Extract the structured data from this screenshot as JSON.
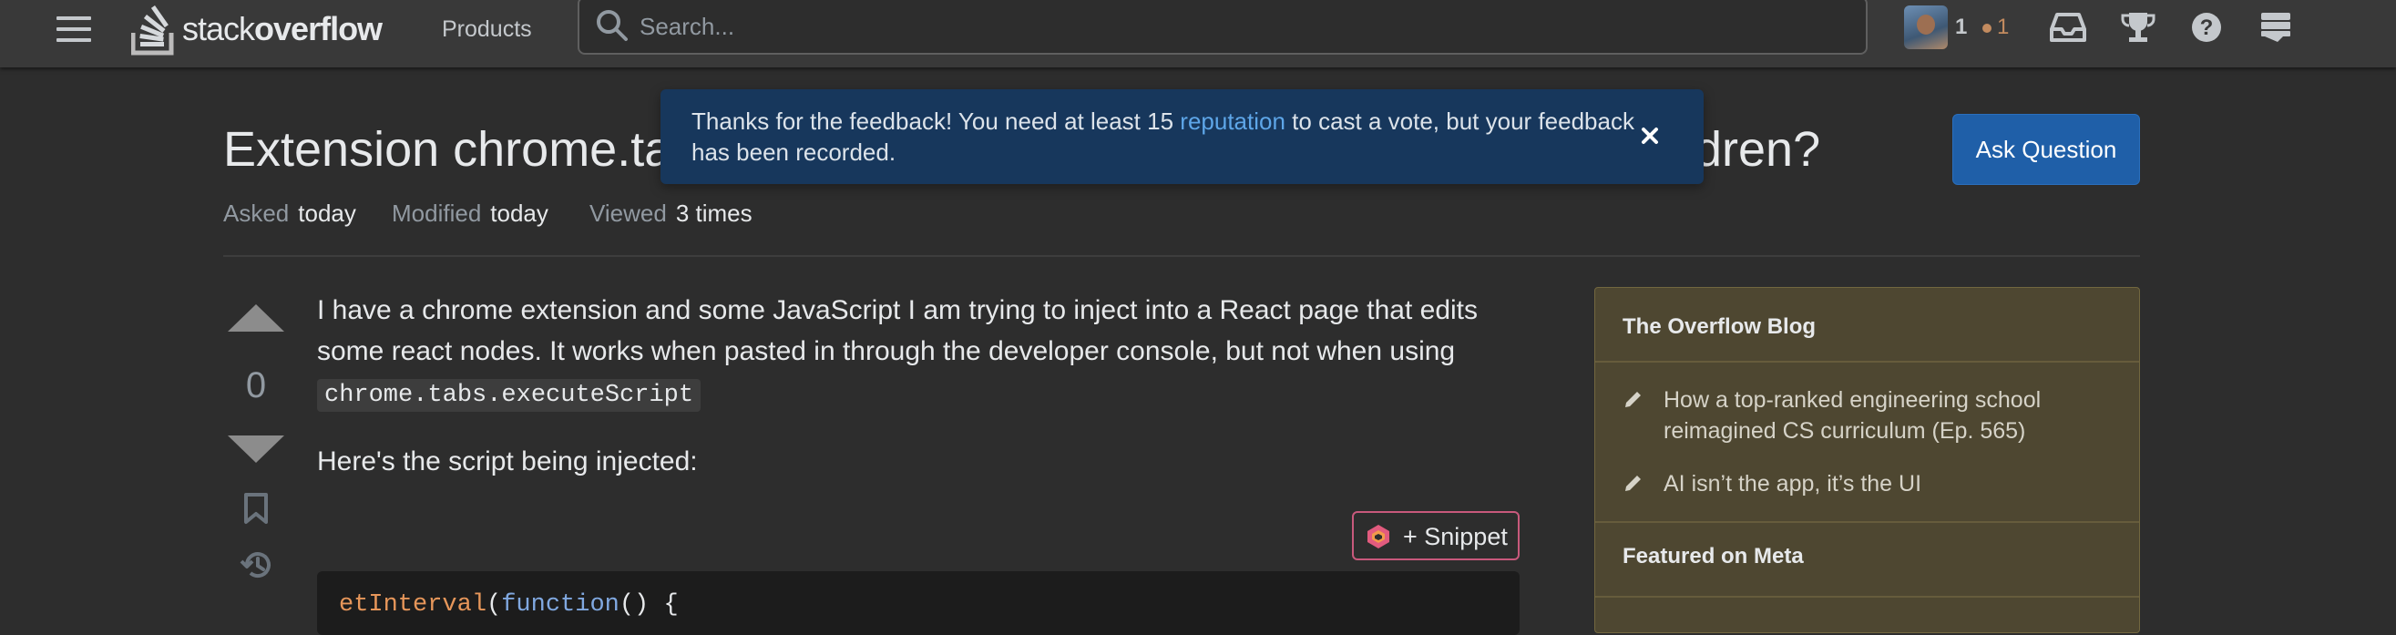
{
  "header": {
    "logo_text_light": "stack",
    "logo_text_bold": "overflow",
    "products_label": "Products",
    "search_placeholder": "Search...",
    "reputation": "1",
    "bronze_badges": "1"
  },
  "question": {
    "title_visible_start": "Extension chrome.tab",
    "title_visible_end": "dren?",
    "ask_button": "Ask Question",
    "asked_label": "Asked",
    "asked_value": "today",
    "modified_label": "Modified",
    "modified_value": "today",
    "viewed_label": "Viewed",
    "viewed_value": "3 times",
    "vote_count": "0",
    "body_text": "I have a chrome extension and some JavaScript I am trying to inject into a React page that edits some react nodes. It works when pasted in through the developer console, but not when using",
    "inline_code": "chrome.tabs.executeScript",
    "body_text_2": "Here's the script being injected:",
    "snippet_button": "+ Snippet",
    "code_fn": "etInterval",
    "code_open": "(",
    "code_kw": "function",
    "code_rest": "() {"
  },
  "toast": {
    "text_before": "Thanks for the feedback! You need at least 15 ",
    "link": "reputation",
    "text_after": " to cast a vote, but your feedback has been recorded."
  },
  "sidebar": {
    "blog_heading": "The Overflow Blog",
    "blog_items": [
      "How a top-ranked engineering school reimagined CS curriculum (Ep. 565)",
      "AI isn’t the app, it’s the UI"
    ],
    "meta_heading": "Featured on Meta"
  },
  "colors": {
    "accent_blue": "#1f5fa8",
    "toast_bg": "#17375c",
    "link": "#5ea6e8",
    "sidebar_bg": "#4e4731"
  },
  "icons": [
    "hamburger-icon",
    "stackoverflow-logo-icon",
    "search-icon",
    "inbox-icon",
    "trophy-icon",
    "help-icon",
    "stackexchange-icon",
    "close-icon",
    "upvote-icon",
    "downvote-icon",
    "bookmark-icon",
    "history-icon",
    "snippet-icon",
    "pencil-icon"
  ]
}
